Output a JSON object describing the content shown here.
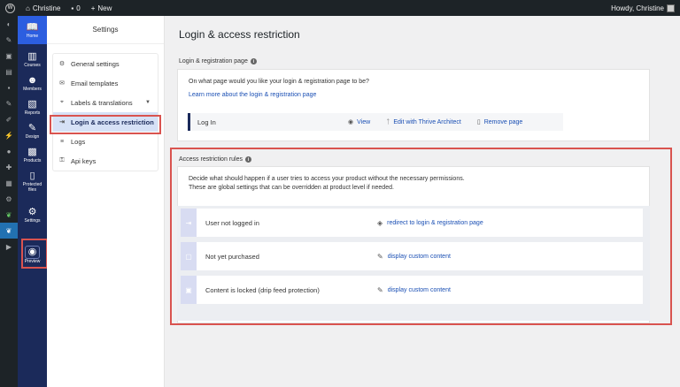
{
  "adminbar": {
    "site_name": "Christine",
    "comments_count": "0",
    "new_label": "New",
    "howdy": "Howdy, Christine"
  },
  "trail": {
    "items": [
      {
        "label": "Home",
        "icon": "book-icon"
      },
      {
        "label": "Courses",
        "icon": "courses-icon"
      },
      {
        "label": "Members",
        "icon": "members-icon"
      },
      {
        "label": "Reports",
        "icon": "reports-icon"
      },
      {
        "label": "Design",
        "icon": "brush-icon"
      },
      {
        "label": "Products",
        "icon": "products-icon"
      },
      {
        "label": "Protected files",
        "icon": "file-lock-icon"
      },
      {
        "label": "Settings",
        "icon": "gear-icon"
      },
      {
        "label": "Preview",
        "icon": "eye-icon"
      }
    ]
  },
  "subnav": {
    "title": "Settings",
    "items": [
      {
        "label": "General settings",
        "icon": "gear-icon"
      },
      {
        "label": "Email templates",
        "icon": "mail-icon"
      },
      {
        "label": "Labels & translations",
        "icon": "tag-icon"
      },
      {
        "label": "Login & access restriction",
        "icon": "login-icon"
      },
      {
        "label": "Logs",
        "icon": "list-icon"
      },
      {
        "label": "Api keys",
        "icon": "key-icon"
      }
    ]
  },
  "main": {
    "title": "Login & access restriction",
    "login_section": {
      "label": "Login & registration page",
      "question": "On what page would you like your login & registration page to be?",
      "learn_more": "Learn more about the login & registration page",
      "page_name": "Log In",
      "view": "View",
      "edit": "Edit with Thrive Architect",
      "remove": "Remove page"
    },
    "rules_section": {
      "label": "Access restriction rules",
      "desc1": "Decide what should happen if a user tries to access your product without the necessary permissions.",
      "desc2": "These are global settings that can be overridden at product level if needed.",
      "rules": [
        {
          "name": "User not logged in",
          "action": "redirect to login & registration page",
          "icon": "login-arrow-icon",
          "action_icon": "redirect-icon"
        },
        {
          "name": "Not yet purchased",
          "action": "display custom content",
          "icon": "bag-icon",
          "action_icon": "edit-icon"
        },
        {
          "name": "Content is locked (drip feed protection)",
          "action": "display custom content",
          "icon": "lock-icon",
          "action_icon": "edit-icon"
        }
      ]
    }
  },
  "colors": {
    "accent": "#1a4fb4",
    "trail_bg": "#1b2a5a",
    "highlight": "#d9534f"
  }
}
